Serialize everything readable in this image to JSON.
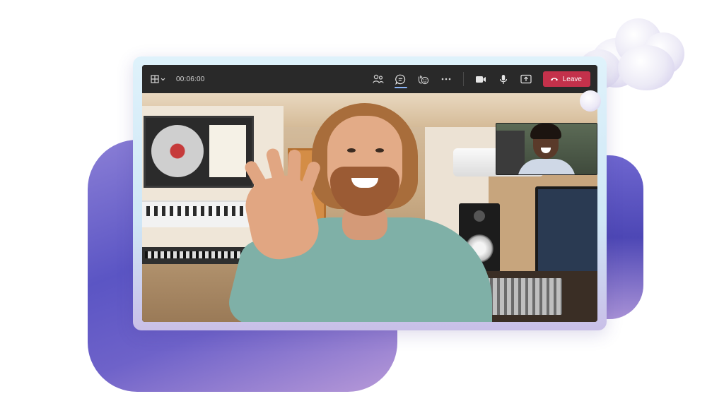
{
  "call": {
    "timer": "00:06:00",
    "leave_label": "Leave"
  },
  "icons": {
    "layout": "layout-grid-icon",
    "people": "people-icon",
    "chat": "chat-icon",
    "react": "reactions-icon",
    "more": "more-icon",
    "camera": "camera-icon",
    "mic": "mic-icon",
    "share": "share-screen-icon",
    "hangup": "hang-up-icon"
  },
  "colors": {
    "toolbar_bg": "#292929",
    "leave_red": "#c4314b",
    "accent_blue": "#8ab4f8"
  }
}
